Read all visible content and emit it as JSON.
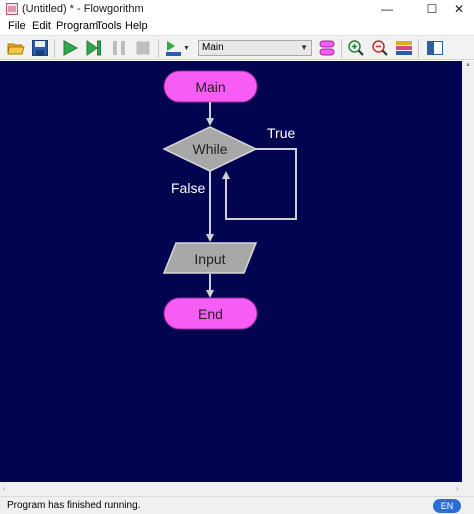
{
  "window": {
    "title": "(Untitled) * - Flowgorithm",
    "min_glyph": "—",
    "max_glyph": "☐",
    "close_glyph": "✕"
  },
  "menu": {
    "items": [
      {
        "label": "File"
      },
      {
        "label": "Edit"
      },
      {
        "label": "Program"
      },
      {
        "label": "Tools"
      },
      {
        "label": "Help"
      }
    ]
  },
  "toolbar": {
    "function_select": {
      "value": "Main"
    },
    "icons": [
      "open-folder-icon",
      "save-icon",
      "run-icon",
      "step-icon",
      "pause-icon",
      "stop-icon",
      "run-speed-icon",
      "function-manager-icon",
      "zoom-in-icon",
      "zoom-out-icon",
      "style-icon",
      "layout-icon"
    ],
    "colors": {
      "run": "#2fa84f",
      "save": "#2a5ca8",
      "folder": "#e3a81d"
    }
  },
  "flowchart": {
    "colors": {
      "background": "#02044f",
      "terminal": "#f75cf5",
      "decision": "#a8a8a8",
      "input": "#a8a8a8",
      "arrow": "#d0d0d0"
    },
    "nodes": {
      "start": {
        "label": "Main"
      },
      "loop": {
        "label": "While"
      },
      "input": {
        "label": "Input"
      },
      "end": {
        "label": "End"
      }
    },
    "edges": {
      "true_label": "True",
      "false_label": "False"
    }
  },
  "status": {
    "message": "Program has finished running.",
    "language": "EN"
  }
}
